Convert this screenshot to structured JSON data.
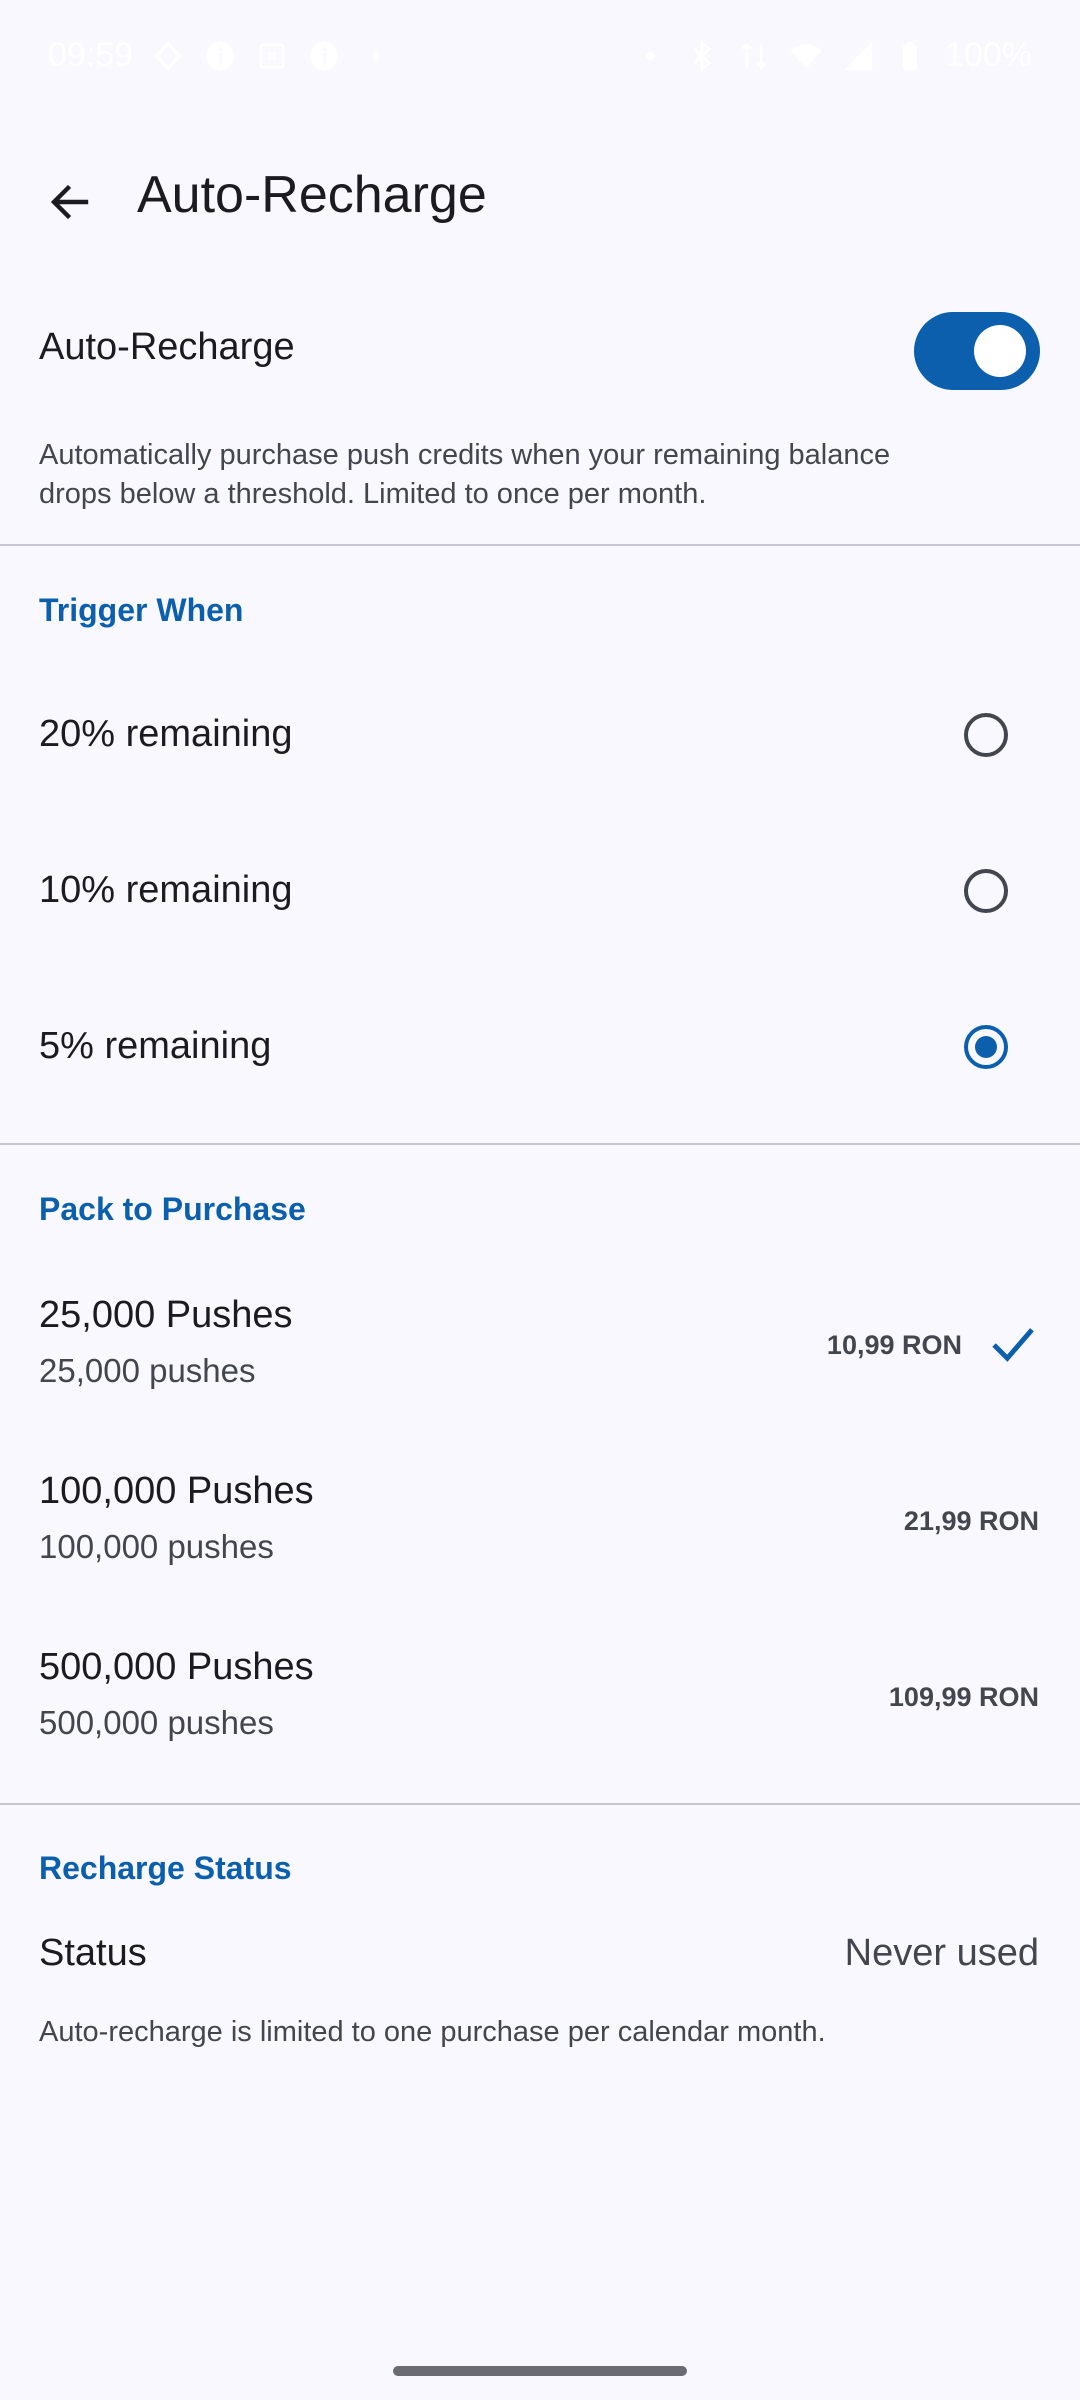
{
  "status_bar": {
    "time": "09:59",
    "battery": "100%"
  },
  "header": {
    "title": "Auto-Recharge"
  },
  "auto_recharge": {
    "label": "Auto-Recharge",
    "enabled": true,
    "description_line1": "Automatically purchase push credits when your remaining balance",
    "description_line2": "drops below a threshold. Limited to once per month."
  },
  "trigger": {
    "heading": "Trigger When",
    "options": [
      {
        "label": "20% remaining",
        "selected": false
      },
      {
        "label": "10% remaining",
        "selected": false
      },
      {
        "label": "5% remaining",
        "selected": true
      }
    ]
  },
  "packs": {
    "heading": "Pack to Purchase",
    "items": [
      {
        "title": "25,000 Pushes",
        "subtitle": "25,000 pushes",
        "price": "10,99 RON",
        "selected": true
      },
      {
        "title": "100,000 Pushes",
        "subtitle": "100,000 pushes",
        "price": "21,99 RON",
        "selected": false
      },
      {
        "title": "500,000 Pushes",
        "subtitle": "500,000 pushes",
        "price": "109,99 RON",
        "selected": false
      }
    ]
  },
  "recharge_status": {
    "heading": "Recharge Status",
    "label": "Status",
    "value": "Never used",
    "note": "Auto-recharge is limited to one purchase per calendar month."
  },
  "colors": {
    "accent": "#0b5fad",
    "background": "#f8f8fe",
    "divider": "#c6c6d0"
  }
}
